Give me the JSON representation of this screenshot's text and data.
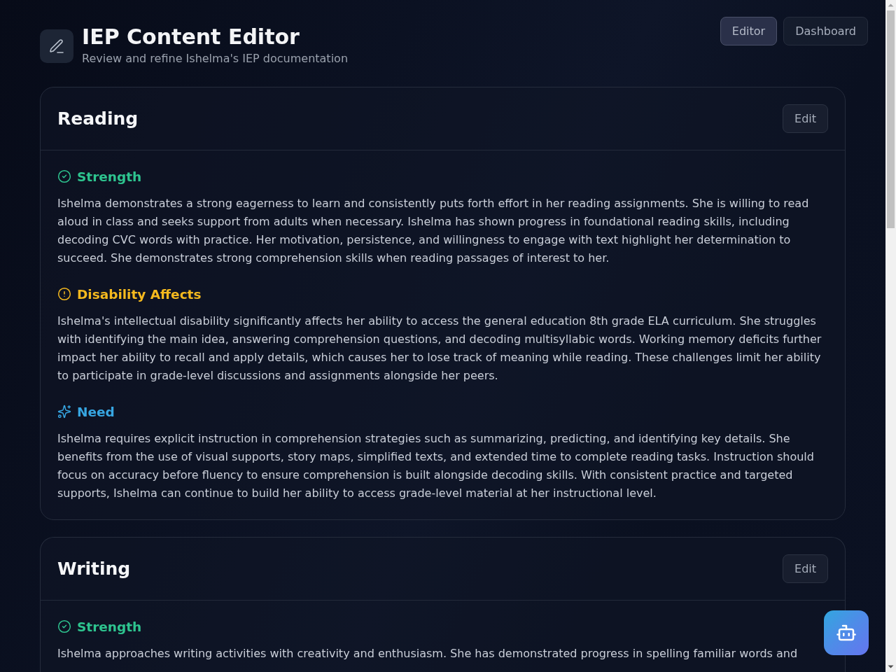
{
  "header": {
    "title": "IEP Content Editor",
    "subtitle": "Review and refine Ishelma's IEP documentation"
  },
  "nav": [
    {
      "label": "Editor",
      "selected": true
    },
    {
      "label": "Dashboard",
      "selected": false
    }
  ],
  "sections": [
    {
      "title": "Reading",
      "edit_button": "Edit",
      "blocks": [
        {
          "kind": "strength",
          "heading": "Strength",
          "text": "Ishelma demonstrates a strong eagerness to learn and consistently puts forth effort in her reading assignments. She is willing to read aloud in class and seeks support from adults when necessary. Ishelma has shown progress in foundational reading skills, including decoding CVC words with practice. Her motivation, persistence, and willingness to engage with text highlight her determination to succeed. She demonstrates strong comprehension skills when reading passages of interest to her."
        },
        {
          "kind": "impact",
          "heading": "Disability Affects",
          "text": "Ishelma's intellectual disability significantly affects her ability to access the general education 8th grade ELA curriculum. She struggles with identifying the main idea, answering comprehension questions, and decoding multisyllabic words. Working memory deficits further impact her ability to recall and apply details, which causes her to lose track of meaning while reading. These challenges limit her ability to participate in grade-level discussions and assignments alongside her peers."
        },
        {
          "kind": "need",
          "heading": "Need",
          "text": "Ishelma requires explicit instruction in comprehension strategies such as summarizing, predicting, and identifying key details. She benefits from the use of visual supports, story maps, simplified texts, and extended time to complete reading tasks. Instruction should focus on accuracy before fluency to ensure comprehension is built alongside decoding skills. With consistent practice and targeted supports, Ishelma can continue to build her ability to access grade-level material at her instructional level."
        }
      ]
    },
    {
      "title": "Writing",
      "edit_button": "Edit",
      "blocks": [
        {
          "kind": "strength",
          "heading": "Strength",
          "text": "Ishelma approaches writing activities with creativity and enthusiasm. She has demonstrated progress in spelling familiar words and"
        }
      ]
    }
  ]
}
